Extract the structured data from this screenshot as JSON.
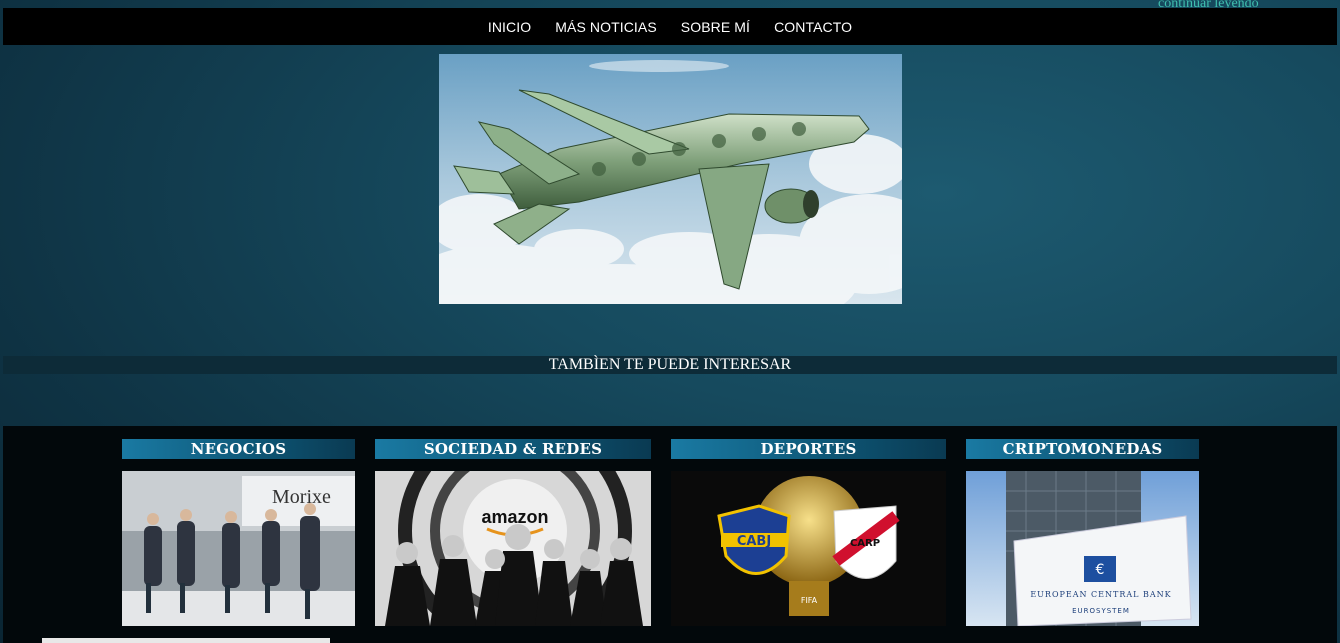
{
  "top_link": "continuar leyendo",
  "nav": {
    "items": [
      {
        "label": "INICIO"
      },
      {
        "label": "MÁS NOTICIAS"
      },
      {
        "label": "SOBRE MÍ"
      },
      {
        "label": "CONTACTO"
      }
    ]
  },
  "hero": {
    "image": "money-airplane-image"
  },
  "interest": {
    "heading": "TAMBÌEN TE PUEDE INTERESAR"
  },
  "cards": [
    {
      "title": "NEGOCIOS",
      "image": "morixe-press-event-photo",
      "sign_text": "Morixe"
    },
    {
      "title": "SOCIEDAD & REDES",
      "image": "amazon-james-bond-photo",
      "logo_text": "amazon"
    },
    {
      "title": "DEPORTES",
      "image": "boca-river-trophy-photo",
      "badge_left": "CABJ",
      "badge_right": "CARP",
      "trophy_text": "FIFA"
    },
    {
      "title": "CRIPTOMONEDAS",
      "image": "ecb-building-photo",
      "sign_text": "EUROPEAN CENTRAL BANK",
      "sign_subtext": "EUROSYSTEM"
    }
  ],
  "colors": {
    "background": "#164a5e",
    "navbar": "#000000",
    "card_title_gradient_start": "#1a7aa3",
    "card_title_gradient_end": "#0a3a52",
    "top_link": "#3fbfae"
  }
}
